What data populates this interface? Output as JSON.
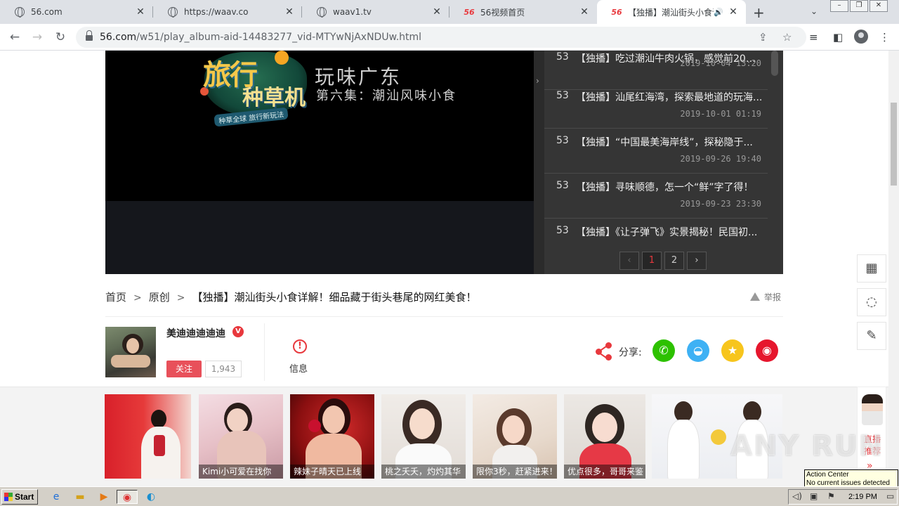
{
  "browser": {
    "tabs": [
      {
        "title": "56.com",
        "favicon": "globe-icon"
      },
      {
        "title": "https://waav.co",
        "favicon": "globe-icon"
      },
      {
        "title": "waav1.tv",
        "favicon": "globe-icon"
      },
      {
        "title": "56视频首页",
        "favicon": "56-logo-icon"
      },
      {
        "title": "【独播】潮汕街头小食详解",
        "favicon": "56-logo-icon",
        "active": true
      }
    ],
    "favicon_56": "56",
    "url_host": "56.com",
    "url_path": "/w51/play_album-aid-14483277_vid-MTYwNjAxNDUw.html"
  },
  "player": {
    "logo_line1": "旅行",
    "logo_line2": "种草机",
    "logo_tagline": "种草全球 旅行新玩法",
    "episode_title": "玩味广东",
    "episode_subtitle": "第六集：潮汕风味小食"
  },
  "playlist": {
    "items": [
      {
        "num": "53",
        "title": "【独播】吃过潮汕牛肉火锅，感觉前20年...",
        "date": "2019-10-04 13:20"
      },
      {
        "num": "53",
        "title": "【独播】汕尾红海湾，探索最地道的玩海...",
        "date": "2019-10-01 01:19"
      },
      {
        "num": "53",
        "title": "【独播】“中国最美海岸线”，探秘隐于...",
        "date": "2019-09-26 19:40"
      },
      {
        "num": "53",
        "title": "【独播】寻味顺德，怎一个“鲜”字了得！",
        "date": "2019-09-23 23:30"
      },
      {
        "num": "53",
        "title": "【独播】《让子弹飞》实景揭秘！民国初...",
        "date": ""
      }
    ],
    "pages": [
      "1",
      "2"
    ],
    "current_page": "1",
    "prev": "‹",
    "next": "›"
  },
  "breadcrumb": {
    "home": "首页",
    "category": "原创",
    "separator": ">",
    "video_title": "【独播】潮汕街头小食详解！细品藏于街头巷尾的网红美食！"
  },
  "report_label": "举报",
  "uploader": {
    "name": "美迪迪迪迪迪",
    "verified_badge": "V",
    "follow_label": "关注",
    "follower_count": "1,943"
  },
  "info_label": "信息",
  "info_icon": "!",
  "share": {
    "label": "分享:",
    "buttons": [
      {
        "name": "wechat",
        "color": "#2dc100"
      },
      {
        "name": "qq",
        "color": "#3eb1f4"
      },
      {
        "name": "qzone",
        "color": "#f7c51d"
      },
      {
        "name": "weibo",
        "color": "#e6162d"
      }
    ]
  },
  "side_tools": [
    "qr-code-icon",
    "lightbulb-icon",
    "feedback-icon"
  ],
  "recommendations": [
    {
      "caption": ""
    },
    {
      "caption": "Kimi小可爱在找你"
    },
    {
      "caption": "辣妹子晴天已上线"
    },
    {
      "caption": "桃之夭夭，灼灼其华"
    },
    {
      "caption": "限你3秒，赶紧进来！"
    },
    {
      "caption": "优点很多，哥哥来鉴"
    },
    {
      "caption": ""
    }
  ],
  "live": {
    "label": "直播推荐",
    "arrow": "»"
  },
  "watermark": "ANY RUN",
  "action_center": {
    "title": "Action Center",
    "message": "No current issues detected"
  },
  "taskbar": {
    "start_label": "Start",
    "clock": "2:19 PM"
  },
  "colors": {
    "accent": "#e8383d",
    "playlist_bg": "#353535"
  }
}
